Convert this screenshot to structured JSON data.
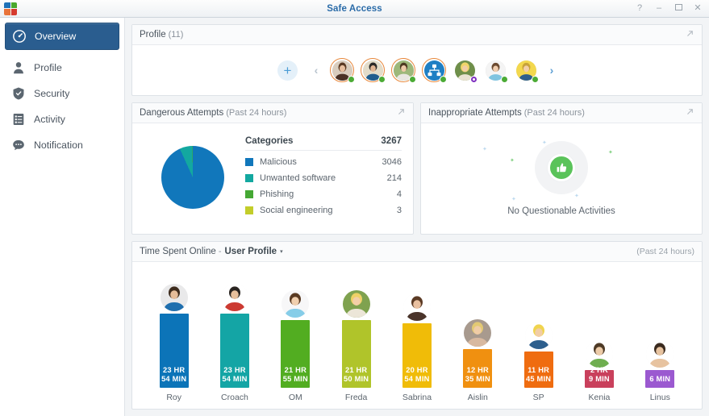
{
  "window": {
    "title": "Safe Access",
    "app_icon": "safe-access-icon",
    "controls": {
      "help": "?",
      "minimize": "–",
      "maximize": "□",
      "close": "✕"
    }
  },
  "sidebar": {
    "items": [
      {
        "label": "Overview",
        "icon": "gauge-icon",
        "active": true
      },
      {
        "label": "Profile",
        "icon": "person-icon",
        "active": false
      },
      {
        "label": "Security",
        "icon": "shield-icon",
        "active": false
      },
      {
        "label": "Activity",
        "icon": "list-document-icon",
        "active": false
      },
      {
        "label": "Notification",
        "icon": "chat-bubble-icon",
        "active": false
      }
    ]
  },
  "profile_panel": {
    "title": "Profile",
    "count_label": "(11)",
    "expand_icon": "expand-arrow-icon",
    "add_label": "+",
    "prev_label": "‹",
    "next_label": "›",
    "avatars": [
      {
        "name": "avatar-1",
        "type": "photo",
        "ring": "orange",
        "status": "online"
      },
      {
        "name": "avatar-2",
        "type": "photo",
        "ring": "orange",
        "status": "online"
      },
      {
        "name": "avatar-3",
        "type": "photo",
        "ring": "orange",
        "status": "online"
      },
      {
        "name": "avatar-group",
        "type": "group",
        "ring": "orange",
        "status": "online"
      },
      {
        "name": "avatar-5",
        "type": "photo",
        "ring": "none",
        "status": "custom"
      },
      {
        "name": "avatar-6",
        "type": "photo",
        "ring": "none",
        "status": "online"
      },
      {
        "name": "avatar-7",
        "type": "photo",
        "ring": "none",
        "status": "online"
      }
    ]
  },
  "dangerous_panel": {
    "title": "Dangerous Attempts",
    "subtitle": "(Past 24 hours)",
    "expand_icon": "expand-arrow-icon",
    "col_header": "Categories",
    "total": "3267"
  },
  "inappropriate_panel": {
    "title": "Inappropriate Attempts",
    "subtitle": "(Past 24 hours)",
    "expand_icon": "expand-arrow-icon",
    "status_text": "No Questionable Activities",
    "status_icon": "thumbs-up-icon",
    "status_color": "#5ac35a"
  },
  "time_panel": {
    "title": "Time Spent Online",
    "separator": "-",
    "selector_label": "User Profile",
    "caret": "▾",
    "period": "(Past 24 hours)"
  },
  "chart_data": [
    {
      "type": "pie",
      "title": "Dangerous Attempts (Past 24 hours)",
      "total": 3267,
      "categories": [
        "Malicious",
        "Unwanted software",
        "Phishing",
        "Social engineering"
      ],
      "values": [
        3046,
        214,
        4,
        3
      ],
      "value_labels": [
        "3046",
        "214",
        "4",
        "3"
      ],
      "colors": [
        "#1177bb",
        "#13a8a0",
        "#45a834",
        "#c3cd2a"
      ],
      "legend": "right"
    },
    {
      "type": "bar",
      "title": "Time Spent Online - User Profile",
      "subtitle": "(Past 24 hours)",
      "xlabel": "",
      "ylabel": "Time spent online",
      "categories": [
        "Roy",
        "Croach",
        "OM",
        "Freda",
        "Sabrina",
        "Aislin",
        "SP",
        "Kenia",
        "Linus"
      ],
      "values": [
        1434,
        1434,
        1315,
        1310,
        1254,
        755,
        705,
        129,
        6
      ],
      "unit": "minutes",
      "ylim": [
        0,
        1440
      ],
      "grid": false,
      "data_labels": [
        "23 HR\n54 MIN",
        "23 HR\n54 MIN",
        "21 HR\n55 MIN",
        "21 HR\n50 MIN",
        "20 HR\n54 MIN",
        "12 HR\n35 MIN",
        "11 HR\n45 MIN",
        "2 HR\n9 MIN",
        "6 MIN"
      ],
      "colors": [
        "#0c74b8",
        "#14a5a5",
        "#52ad21",
        "#b0c42a",
        "#f0bc08",
        "#f09010",
        "#ef6c10",
        "#c9405c",
        "#9b59d0"
      ]
    }
  ],
  "bars": [
    {
      "name": "Roy",
      "line1": "23 HR",
      "line2": "54 MIN",
      "minutes": 1434,
      "color": "#0c74b8"
    },
    {
      "name": "Croach",
      "line1": "23 HR",
      "line2": "54 MIN",
      "minutes": 1434,
      "color": "#14a5a5"
    },
    {
      "name": "OM",
      "line1": "21 HR",
      "line2": "55 MIN",
      "minutes": 1315,
      "color": "#52ad21"
    },
    {
      "name": "Freda",
      "line1": "21 HR",
      "line2": "50 MIN",
      "minutes": 1310,
      "color": "#b0c42a"
    },
    {
      "name": "Sabrina",
      "line1": "20 HR",
      "line2": "54 MIN",
      "minutes": 1254,
      "color": "#f0bc08"
    },
    {
      "name": "Aislin",
      "line1": "12 HR",
      "line2": "35 MIN",
      "minutes": 755,
      "color": "#f09010"
    },
    {
      "name": "SP",
      "line1": "11 HR",
      "line2": "45 MIN",
      "minutes": 705,
      "color": "#ef6c10"
    },
    {
      "name": "Kenia",
      "line1": "2 HR",
      "line2": "9 MIN",
      "minutes": 129,
      "color": "#c9405c"
    },
    {
      "name": "Linus",
      "line1": "6 MIN",
      "line2": "",
      "minutes": 6,
      "color": "#9b59d0"
    }
  ],
  "legend_rows": [
    {
      "label": "Malicious",
      "value": "3046",
      "color": "#1177bb"
    },
    {
      "label": "Unwanted software",
      "value": "214",
      "color": "#13a8a0"
    },
    {
      "label": "Phishing",
      "value": "4",
      "color": "#45a834"
    },
    {
      "label": "Social engineering",
      "value": "3",
      "color": "#c3cd2a"
    }
  ]
}
